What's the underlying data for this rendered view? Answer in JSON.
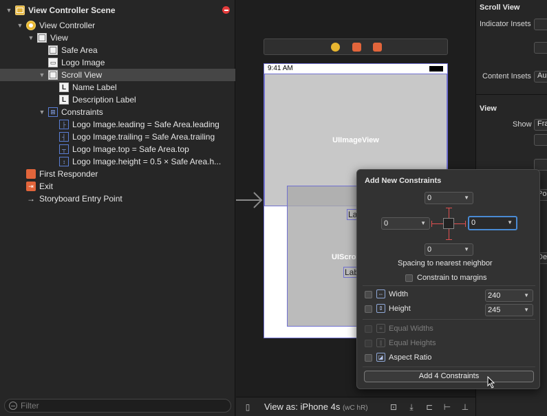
{
  "outline": {
    "items": [
      {
        "label": "View Controller Scene"
      },
      {
        "label": "View Controller"
      },
      {
        "label": "View"
      },
      {
        "label": "Safe Area"
      },
      {
        "label": "Logo Image"
      },
      {
        "label": "Scroll View"
      },
      {
        "label": "Name Label"
      },
      {
        "label": "Description Label"
      },
      {
        "label": "Constraints"
      },
      {
        "label": "Logo Image.leading = Safe Area.leading"
      },
      {
        "label": "Logo Image.trailing = Safe Area.trailing"
      },
      {
        "label": "Logo Image.top = Safe Area.top"
      },
      {
        "label": "Logo Image.height = 0.5 × Safe Area.h..."
      },
      {
        "label": "First Responder"
      },
      {
        "label": "Exit"
      },
      {
        "label": "Storyboard Entry Point"
      }
    ],
    "filter_placeholder": "Filter"
  },
  "canvas": {
    "status_time": "9:41 AM",
    "imageview_label": "UIImageView",
    "scrollview_label": "UIScro",
    "label1": "Lab",
    "label2": "Lab",
    "view_as": "View as: iPhone 4s",
    "size_class": "(wC hR)"
  },
  "inspector": {
    "section_scroll_view": "Scroll View",
    "indicator_insets": "Indicator Insets",
    "content_insets": "Content Insets",
    "content_insets_value": "Au",
    "section_view": "View",
    "show": "Show",
    "show_value": "Fra",
    "frag1": "Po",
    "frag2": "De"
  },
  "popover": {
    "title": "Add New Constraints",
    "top_value": "0",
    "left_value": "0",
    "right_value": "0",
    "bottom_value": "0",
    "spacing_text": "Spacing to nearest neighbor",
    "constrain_margins": "Constrain to margins",
    "width_label": "Width",
    "width_value": "240",
    "height_label": "Height",
    "height_value": "245",
    "equal_widths": "Equal Widths",
    "equal_heights": "Equal Heights",
    "aspect_ratio": "Aspect Ratio",
    "add_button": "Add 4 Constraints"
  }
}
